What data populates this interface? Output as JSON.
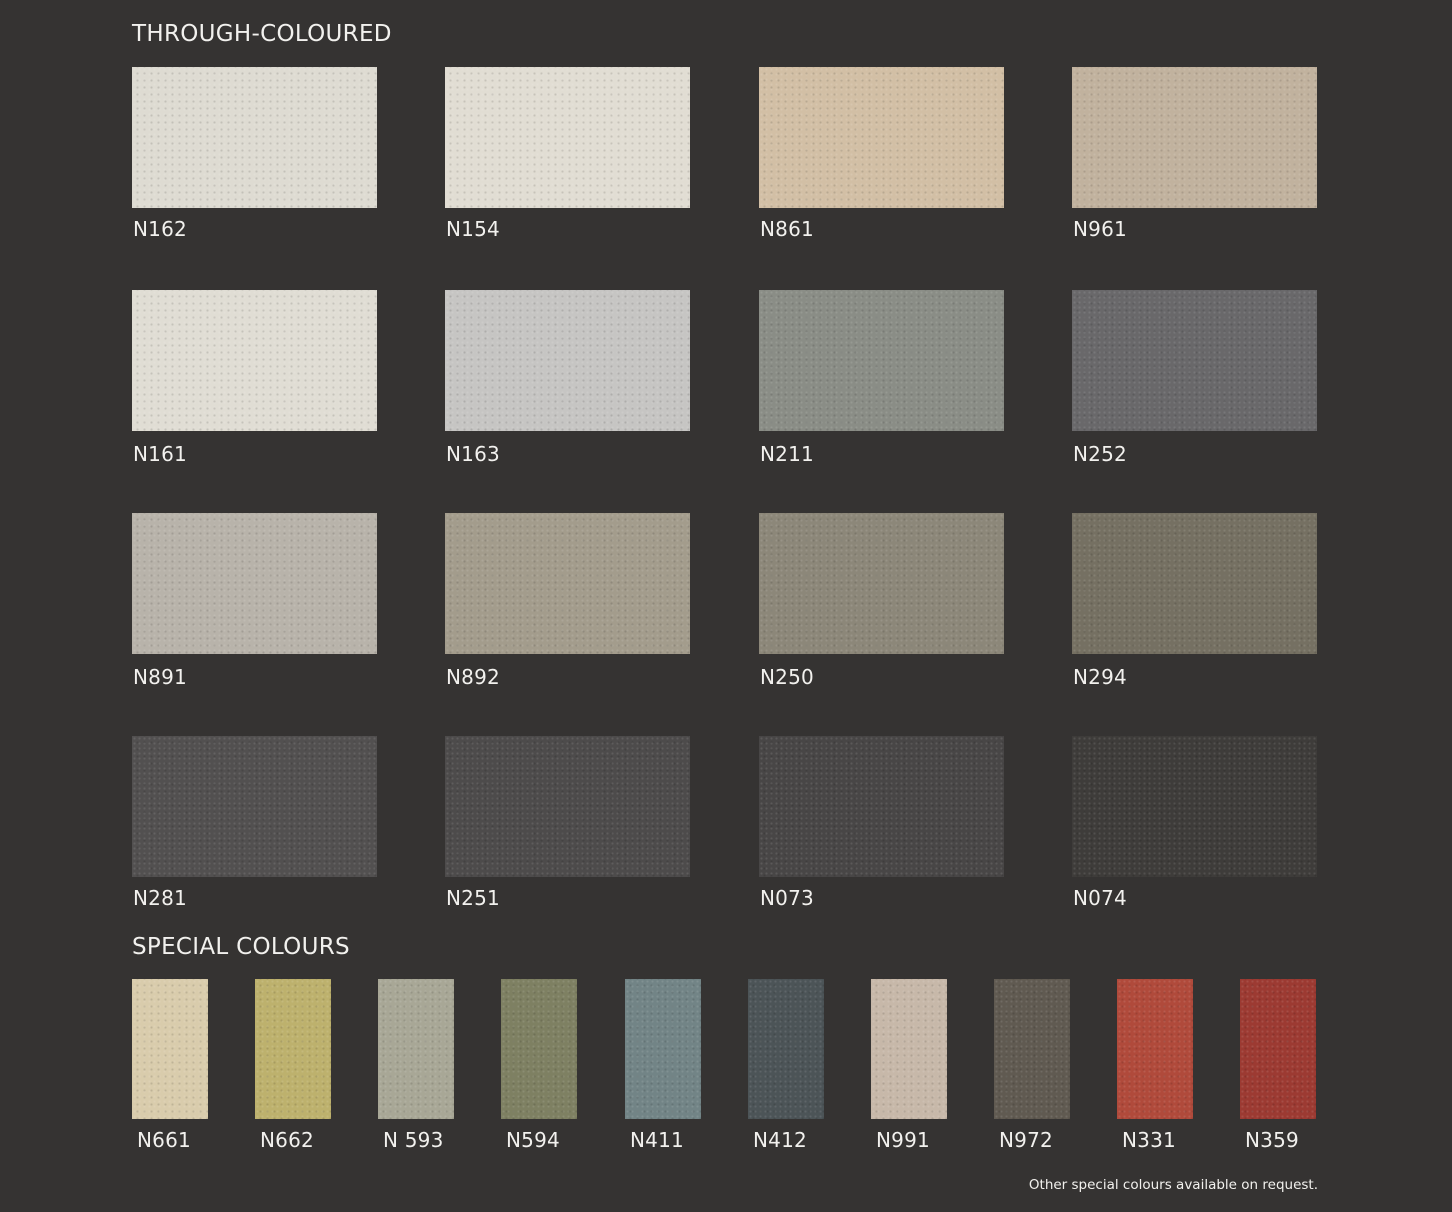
{
  "sections": {
    "through_coloured": {
      "title": "THROUGH-COLOURED",
      "swatches": [
        {
          "code": "N162",
          "color": "#dedbd2"
        },
        {
          "code": "N154",
          "color": "#e1ddd3"
        },
        {
          "code": "N861",
          "color": "#d2bfa5"
        },
        {
          "code": "N961",
          "color": "#c1b29e"
        },
        {
          "code": "N161",
          "color": "#e0ddd4"
        },
        {
          "code": "N163",
          "color": "#c6c5c3"
        },
        {
          "code": "N211",
          "color": "#8a8d86"
        },
        {
          "code": "N252",
          "color": "#69686a"
        },
        {
          "code": "N891",
          "color": "#b8b3aa"
        },
        {
          "code": "N892",
          "color": "#a39c8c"
        },
        {
          "code": "N250",
          "color": "#8c8779"
        },
        {
          "code": "N294",
          "color": "#757062"
        },
        {
          "code": "N281",
          "color": "#525050"
        },
        {
          "code": "N251",
          "color": "#4d4b4b"
        },
        {
          "code": "N073",
          "color": "#484646"
        },
        {
          "code": "N074",
          "color": "#3e3c3a"
        }
      ]
    },
    "special_colours": {
      "title": "SPECIAL COLOURS",
      "swatches": [
        {
          "code": "N661",
          "color": "#d9ccac"
        },
        {
          "code": "N662",
          "color": "#bdb16d"
        },
        {
          "code": "N 593",
          "color": "#a8a796"
        },
        {
          "code": "N594",
          "color": "#7e8062"
        },
        {
          "code": "N411",
          "color": "#728486"
        },
        {
          "code": "N412",
          "color": "#4c5457"
        },
        {
          "code": "N991",
          "color": "#c7b8a9"
        },
        {
          "code": "N972",
          "color": "#605a51"
        },
        {
          "code": "N331",
          "color": "#b04a3b"
        },
        {
          "code": "N359",
          "color": "#9c3a32"
        }
      ]
    }
  },
  "footnote": "Other special colours available on request."
}
